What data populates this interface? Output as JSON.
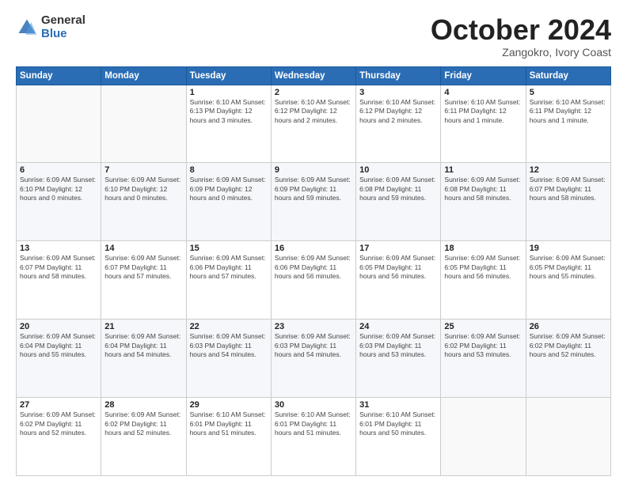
{
  "logo": {
    "general": "General",
    "blue": "Blue"
  },
  "header": {
    "title": "October 2024",
    "location": "Zangokro, Ivory Coast"
  },
  "columns": [
    "Sunday",
    "Monday",
    "Tuesday",
    "Wednesday",
    "Thursday",
    "Friday",
    "Saturday"
  ],
  "weeks": [
    [
      {
        "day": "",
        "info": ""
      },
      {
        "day": "",
        "info": ""
      },
      {
        "day": "1",
        "info": "Sunrise: 6:10 AM\nSunset: 6:13 PM\nDaylight: 12 hours\nand 3 minutes."
      },
      {
        "day": "2",
        "info": "Sunrise: 6:10 AM\nSunset: 6:12 PM\nDaylight: 12 hours\nand 2 minutes."
      },
      {
        "day": "3",
        "info": "Sunrise: 6:10 AM\nSunset: 6:12 PM\nDaylight: 12 hours\nand 2 minutes."
      },
      {
        "day": "4",
        "info": "Sunrise: 6:10 AM\nSunset: 6:11 PM\nDaylight: 12 hours\nand 1 minute."
      },
      {
        "day": "5",
        "info": "Sunrise: 6:10 AM\nSunset: 6:11 PM\nDaylight: 12 hours\nand 1 minute."
      }
    ],
    [
      {
        "day": "6",
        "info": "Sunrise: 6:09 AM\nSunset: 6:10 PM\nDaylight: 12 hours\nand 0 minutes."
      },
      {
        "day": "7",
        "info": "Sunrise: 6:09 AM\nSunset: 6:10 PM\nDaylight: 12 hours\nand 0 minutes."
      },
      {
        "day": "8",
        "info": "Sunrise: 6:09 AM\nSunset: 6:09 PM\nDaylight: 12 hours\nand 0 minutes."
      },
      {
        "day": "9",
        "info": "Sunrise: 6:09 AM\nSunset: 6:09 PM\nDaylight: 11 hours\nand 59 minutes."
      },
      {
        "day": "10",
        "info": "Sunrise: 6:09 AM\nSunset: 6:08 PM\nDaylight: 11 hours\nand 59 minutes."
      },
      {
        "day": "11",
        "info": "Sunrise: 6:09 AM\nSunset: 6:08 PM\nDaylight: 11 hours\nand 58 minutes."
      },
      {
        "day": "12",
        "info": "Sunrise: 6:09 AM\nSunset: 6:07 PM\nDaylight: 11 hours\nand 58 minutes."
      }
    ],
    [
      {
        "day": "13",
        "info": "Sunrise: 6:09 AM\nSunset: 6:07 PM\nDaylight: 11 hours\nand 58 minutes."
      },
      {
        "day": "14",
        "info": "Sunrise: 6:09 AM\nSunset: 6:07 PM\nDaylight: 11 hours\nand 57 minutes."
      },
      {
        "day": "15",
        "info": "Sunrise: 6:09 AM\nSunset: 6:06 PM\nDaylight: 11 hours\nand 57 minutes."
      },
      {
        "day": "16",
        "info": "Sunrise: 6:09 AM\nSunset: 6:06 PM\nDaylight: 11 hours\nand 56 minutes."
      },
      {
        "day": "17",
        "info": "Sunrise: 6:09 AM\nSunset: 6:05 PM\nDaylight: 11 hours\nand 56 minutes."
      },
      {
        "day": "18",
        "info": "Sunrise: 6:09 AM\nSunset: 6:05 PM\nDaylight: 11 hours\nand 56 minutes."
      },
      {
        "day": "19",
        "info": "Sunrise: 6:09 AM\nSunset: 6:05 PM\nDaylight: 11 hours\nand 55 minutes."
      }
    ],
    [
      {
        "day": "20",
        "info": "Sunrise: 6:09 AM\nSunset: 6:04 PM\nDaylight: 11 hours\nand 55 minutes."
      },
      {
        "day": "21",
        "info": "Sunrise: 6:09 AM\nSunset: 6:04 PM\nDaylight: 11 hours\nand 54 minutes."
      },
      {
        "day": "22",
        "info": "Sunrise: 6:09 AM\nSunset: 6:03 PM\nDaylight: 11 hours\nand 54 minutes."
      },
      {
        "day": "23",
        "info": "Sunrise: 6:09 AM\nSunset: 6:03 PM\nDaylight: 11 hours\nand 54 minutes."
      },
      {
        "day": "24",
        "info": "Sunrise: 6:09 AM\nSunset: 6:03 PM\nDaylight: 11 hours\nand 53 minutes."
      },
      {
        "day": "25",
        "info": "Sunrise: 6:09 AM\nSunset: 6:02 PM\nDaylight: 11 hours\nand 53 minutes."
      },
      {
        "day": "26",
        "info": "Sunrise: 6:09 AM\nSunset: 6:02 PM\nDaylight: 11 hours\nand 52 minutes."
      }
    ],
    [
      {
        "day": "27",
        "info": "Sunrise: 6:09 AM\nSunset: 6:02 PM\nDaylight: 11 hours\nand 52 minutes."
      },
      {
        "day": "28",
        "info": "Sunrise: 6:09 AM\nSunset: 6:02 PM\nDaylight: 11 hours\nand 52 minutes."
      },
      {
        "day": "29",
        "info": "Sunrise: 6:10 AM\nSunset: 6:01 PM\nDaylight: 11 hours\nand 51 minutes."
      },
      {
        "day": "30",
        "info": "Sunrise: 6:10 AM\nSunset: 6:01 PM\nDaylight: 11 hours\nand 51 minutes."
      },
      {
        "day": "31",
        "info": "Sunrise: 6:10 AM\nSunset: 6:01 PM\nDaylight: 11 hours\nand 50 minutes."
      },
      {
        "day": "",
        "info": ""
      },
      {
        "day": "",
        "info": ""
      }
    ]
  ]
}
